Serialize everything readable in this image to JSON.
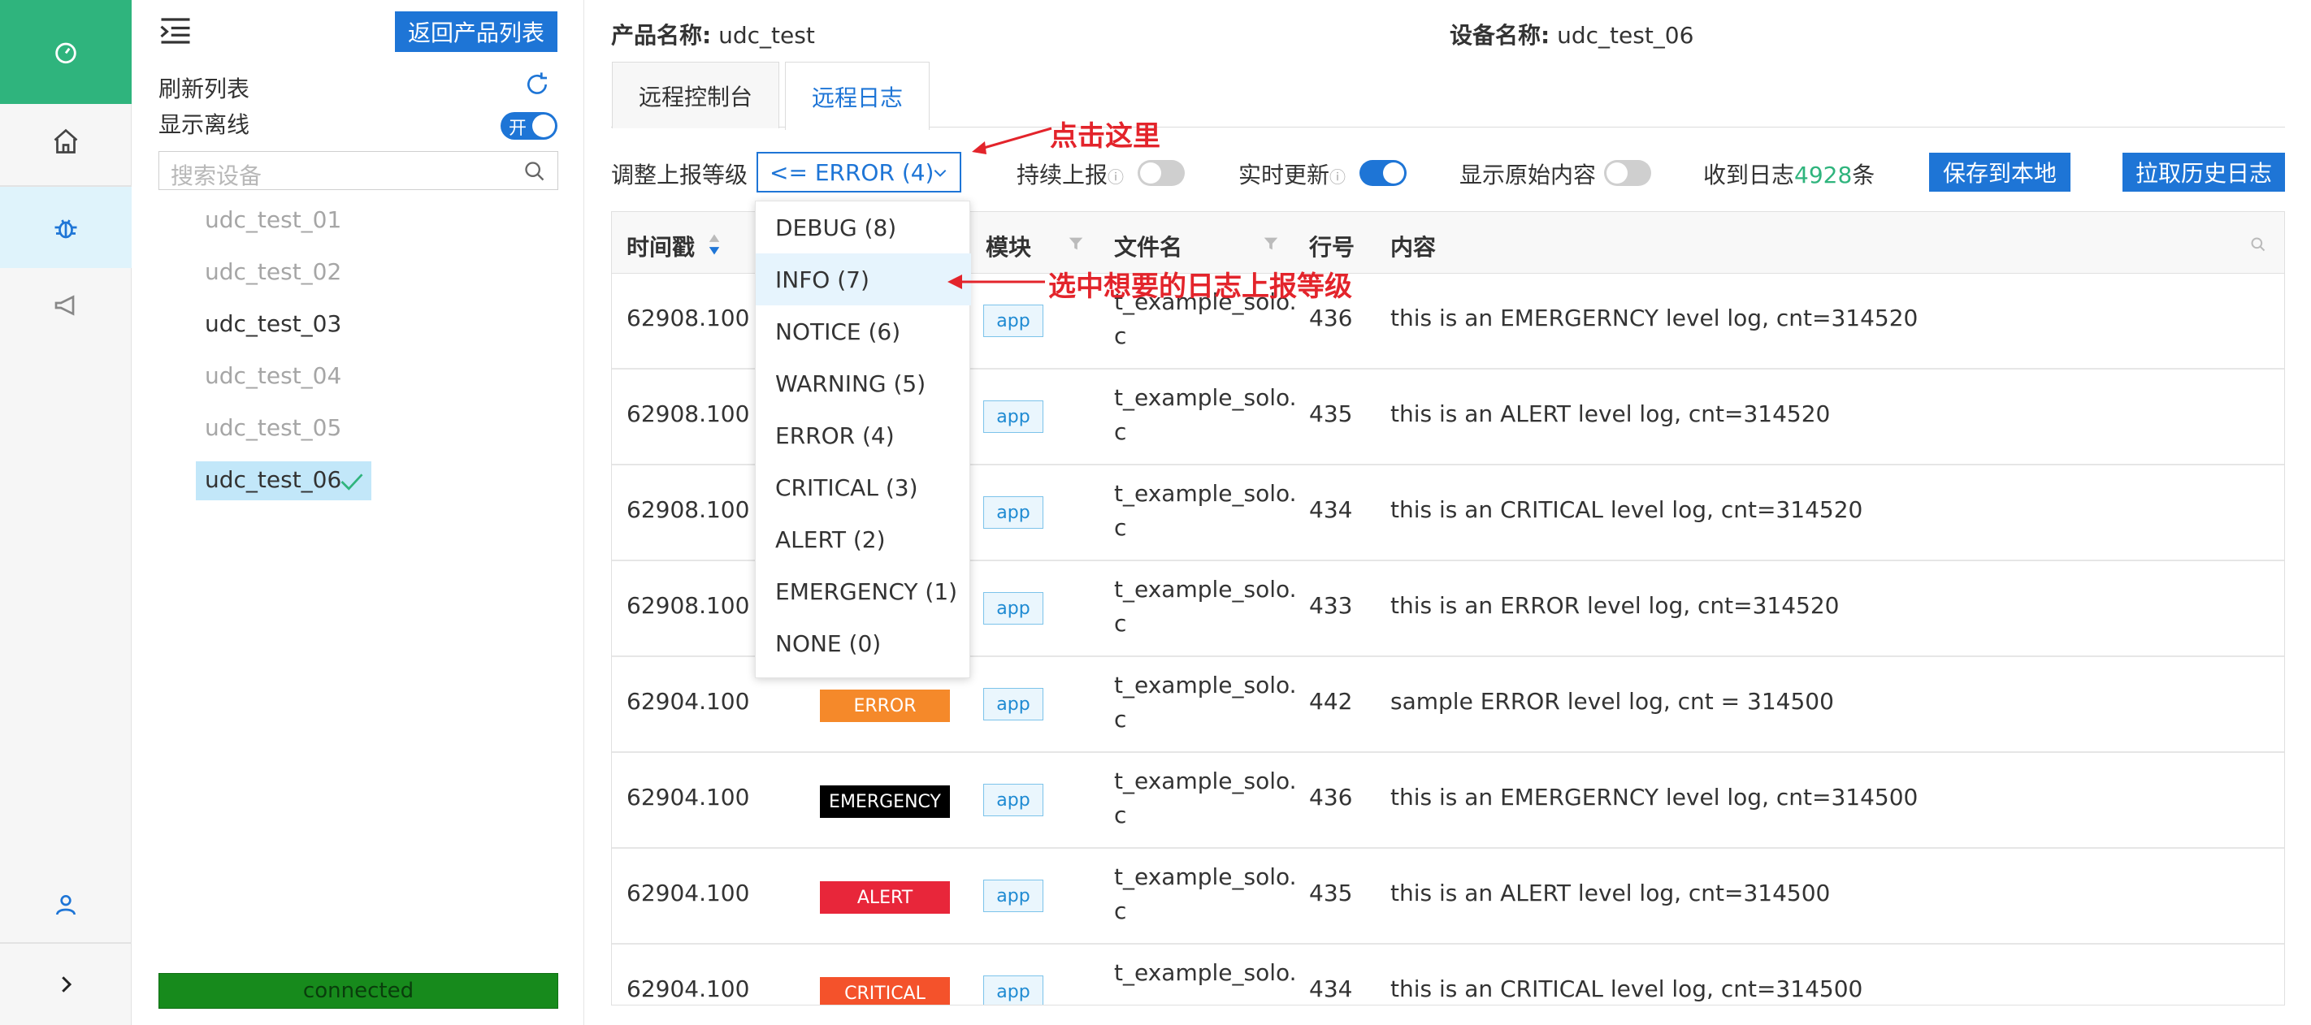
{
  "colors": {
    "brand_green": "#2fb47d",
    "primary_blue": "#1e75d6",
    "connected_green": "#178a1c",
    "count_green": "#2fb47d",
    "annotation_red": "#e3242b"
  },
  "rail": {
    "icons": [
      "dashboard-icon",
      "home-icon",
      "debug-bug-icon",
      "megaphone-icon",
      "user-icon",
      "chevron-right-icon"
    ]
  },
  "device_panel": {
    "back_button": "返回产品列表",
    "refresh_label": "刷新列表",
    "show_offline_label": "显示离线",
    "show_offline_toggle": "开",
    "search_placeholder": "搜索设备",
    "devices": [
      {
        "name": "udc_test_01",
        "online": false
      },
      {
        "name": "udc_test_02",
        "online": false
      },
      {
        "name": "udc_test_03",
        "online": true
      },
      {
        "name": "udc_test_04",
        "online": false
      },
      {
        "name": "udc_test_05",
        "online": false
      },
      {
        "name": "udc_test_06",
        "online": true,
        "selected": true
      }
    ],
    "status": "connected"
  },
  "header": {
    "product_label": "产品名称:",
    "product_value": "udc_test",
    "device_label": "设备名称:",
    "device_value": "udc_test_06"
  },
  "tabs": [
    {
      "label": "远程控制台",
      "active": false
    },
    {
      "label": "远程日志",
      "active": true
    }
  ],
  "controls": {
    "level_label": "调整上报等级",
    "level_value": "<= ERROR (4)",
    "continuous_label": "持续上报",
    "continuous_on": false,
    "realtime_label": "实时更新",
    "realtime_on": true,
    "raw_label": "显示原始内容",
    "raw_on": false,
    "received_prefix": "收到日志",
    "received_count": "4928",
    "received_suffix": "条",
    "save_button": "保存到本地",
    "history_button": "拉取历史日志"
  },
  "dropdown": {
    "options": [
      "DEBUG (8)",
      "INFO (7)",
      "NOTICE (6)",
      "WARNING (5)",
      "ERROR (4)",
      "CRITICAL (3)",
      "ALERT (2)",
      "EMERGENCY (1)",
      "NONE (0)"
    ],
    "highlighted": "INFO (7)"
  },
  "table": {
    "columns": [
      "时间戳",
      "模块",
      "文件名",
      "行号",
      "内容"
    ],
    "rows": [
      {
        "time": "62908.100",
        "level": "",
        "module": "app",
        "file1": "t_example_solo.",
        "file2": "c",
        "line": "436",
        "content": "this is an EMERGERNCY level log, cnt=314520"
      },
      {
        "time": "62908.100",
        "level": "",
        "module": "app",
        "file1": "t_example_solo.",
        "file2": "c",
        "line": "435",
        "content": "this is an ALERT level log, cnt=314520"
      },
      {
        "time": "62908.100",
        "level": "",
        "module": "app",
        "file1": "t_example_solo.",
        "file2": "c",
        "line": "434",
        "content": "this is an CRITICAL level log, cnt=314520"
      },
      {
        "time": "62908.100",
        "level": "",
        "module": "app",
        "file1": "t_example_solo.",
        "file2": "c",
        "line": "433",
        "content": "this is an ERROR level log, cnt=314520"
      },
      {
        "time": "62904.100",
        "level": "ERROR",
        "level_color": "#f5892a",
        "module": "app",
        "file1": "t_example_solo.",
        "file2": "c",
        "line": "442",
        "content": "sample ERROR level log, cnt = 314500"
      },
      {
        "time": "62904.100",
        "level": "EMERGENCY",
        "level_color": "#000000",
        "module": "app",
        "file1": "t_example_solo.",
        "file2": "c",
        "line": "436",
        "content": "this is an EMERGERNCY level log, cnt=314500"
      },
      {
        "time": "62904.100",
        "level": "ALERT",
        "level_color": "#e8263a",
        "module": "app",
        "file1": "t_example_solo.",
        "file2": "c",
        "line": "435",
        "content": "this is an ALERT level log, cnt=314500"
      },
      {
        "time": "62904.100",
        "level": "CRITICAL",
        "level_color": "#f4522b",
        "module": "app",
        "file1": "t_example_solo.",
        "file2": "",
        "line": "434",
        "content": "this is an CRITICAL level log, cnt=314500"
      }
    ]
  },
  "annotations": {
    "click_here": "点击这里",
    "select_level": "选中想要的日志上报等级"
  }
}
